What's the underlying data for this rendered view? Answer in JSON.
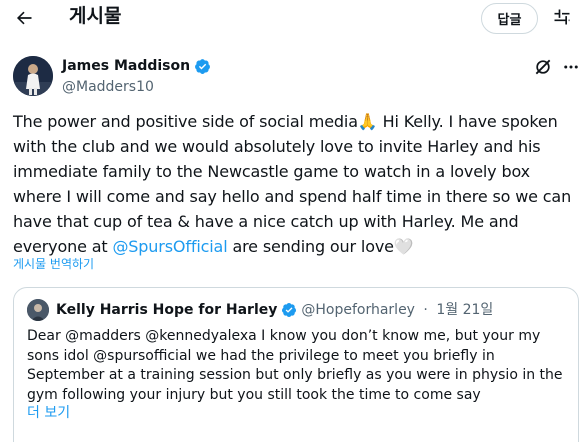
{
  "header": {
    "title": "게시물",
    "reply_label": "답글"
  },
  "tweet": {
    "author_name": "James Maddison",
    "author_handle": "@Madders10",
    "text_1": "The power and positive side of social media",
    "emoji_pray": "🙏",
    "text_2": " Hi Kelly. I have spoken with the club and we would absolutely love to invite Harley and his immediate family to the Newcastle game to watch in a lovely box where I will come and say hello and spend half time in there so we can have that cup of tea & have a nice catch up with Harley. Me and everyone at ",
    "mention": "@SpursOfficial",
    "text_3": " are sending our love",
    "emoji_heart": "🤍",
    "translate_label": "게시물 번역하기"
  },
  "quote": {
    "author_name": "Kelly Harris Hope for Harley",
    "author_handle": "@Hopeforharley",
    "separator": " · ",
    "date": "1월 21일",
    "text": "Dear @madders @kennedyalexa I know you don’t know me,  but your my sons idol @spursofficial we had the privilege to meet you briefly in September at a training session but only briefly as you were in physio in the gym following your injury but you still took the time to come say",
    "more_label": "더 보기"
  },
  "colors": {
    "accent": "#1d9bf0",
    "text": "#0f1419",
    "secondary": "#536471",
    "border": "#cfd9de"
  },
  "icons": [
    "back-arrow-icon",
    "filter-sliders-icon",
    "verified-badge-icon",
    "grok-icon",
    "more-icon"
  ]
}
